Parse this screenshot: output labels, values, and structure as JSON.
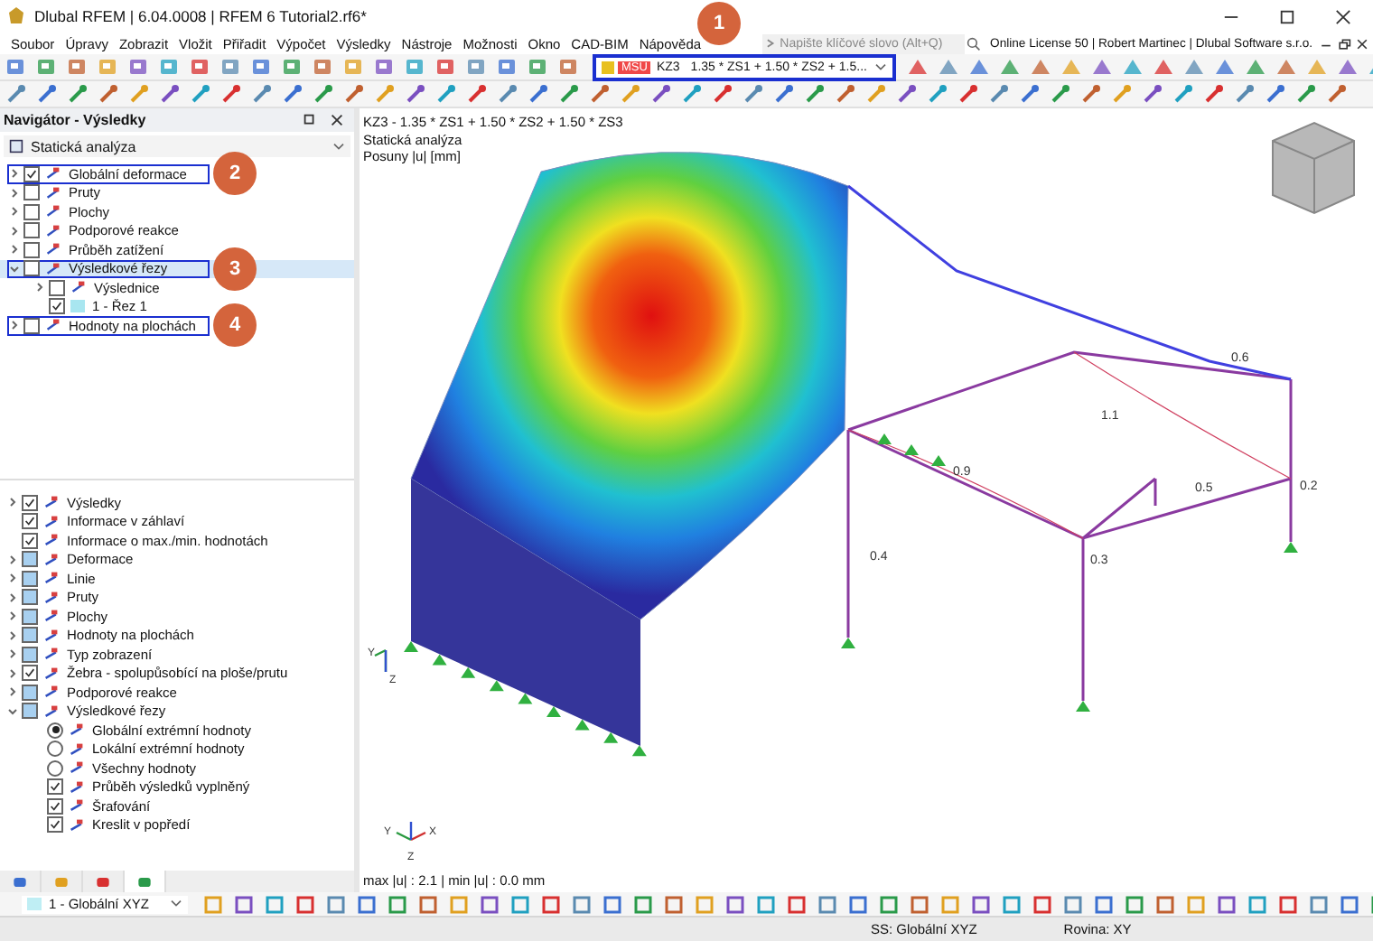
{
  "window": {
    "title": "Dlubal RFEM | 6.04.0008 | RFEM 6 Tutorial2.rf6*"
  },
  "menu": [
    "Soubor",
    "Úpravy",
    "Zobrazit",
    "Vložit",
    "Přiřadit",
    "Výpočet",
    "Výsledky",
    "Nástroje",
    "Možnosti",
    "Okno",
    "CAD-BIM",
    "Nápověda"
  ],
  "search": {
    "placeholder": "Napište klíčové slovo (Alt+Q)"
  },
  "license": "Online License 50 | Robert Martinec | Dlubal Software s.r.o.",
  "load_combination": {
    "type": "MSU",
    "name": "KZ3",
    "formula": "1.35 * ZS1 + 1.50 * ZS2 + 1.5...",
    "highlighted": true,
    "callout": "1"
  },
  "navigator": {
    "title": "Navigátor - Výsledky",
    "analysis": "Statická analýza",
    "tree": [
      {
        "label": "Globální deformace",
        "checked": true,
        "expanded": false,
        "highlighted": true,
        "callout": "2",
        "selected": false
      },
      {
        "label": "Pruty",
        "checked": false,
        "expanded": false,
        "highlighted": false,
        "selected": false
      },
      {
        "label": "Plochy",
        "checked": false,
        "expanded": false,
        "highlighted": false,
        "selected": false
      },
      {
        "label": "Podporové reakce",
        "checked": false,
        "expanded": false,
        "highlighted": false,
        "selected": false
      },
      {
        "label": "Průběh zatížení",
        "checked": false,
        "expanded": false,
        "highlighted": false,
        "selected": false
      },
      {
        "label": "Výsledkové řezy",
        "checked": false,
        "expanded": true,
        "highlighted": true,
        "callout": "3",
        "selected": true,
        "children": [
          {
            "label": "Výslednice",
            "checked": false,
            "expanded": false,
            "highlighted": false,
            "selected": false
          },
          {
            "label": "1 - Řez 1",
            "checked": true,
            "highlighted": false,
            "selected": false,
            "color": "#a8e6f0"
          }
        ]
      },
      {
        "label": "Hodnoty na plochách",
        "checked": false,
        "expanded": false,
        "highlighted": true,
        "callout": "4",
        "selected": false
      }
    ],
    "display": [
      {
        "kind": "checkbox",
        "label": "Výsledky",
        "checked": true,
        "mixed": false,
        "expanded": false
      },
      {
        "kind": "checkbox",
        "label": "Informace v záhlaví",
        "checked": true,
        "mixed": false
      },
      {
        "kind": "checkbox",
        "label": "Informace o max./min. hodnotách",
        "checked": true,
        "mixed": false
      },
      {
        "kind": "checkbox",
        "label": "Deformace",
        "checked": false,
        "mixed": true,
        "expanded": false
      },
      {
        "kind": "checkbox",
        "label": "Linie",
        "checked": false,
        "mixed": true,
        "expanded": false
      },
      {
        "kind": "checkbox",
        "label": "Pruty",
        "checked": false,
        "mixed": true,
        "expanded": false
      },
      {
        "kind": "checkbox",
        "label": "Plochy",
        "checked": false,
        "mixed": true,
        "expanded": false
      },
      {
        "kind": "checkbox",
        "label": "Hodnoty na plochách",
        "checked": false,
        "mixed": true,
        "expanded": false
      },
      {
        "kind": "checkbox",
        "label": "Typ zobrazení",
        "checked": false,
        "mixed": true,
        "expanded": false
      },
      {
        "kind": "checkbox",
        "label": "Žebra - spolupůsobící na ploše/prutu",
        "checked": true,
        "mixed": false,
        "expanded": false
      },
      {
        "kind": "checkbox",
        "label": "Podporové reakce",
        "checked": false,
        "mixed": true,
        "expanded": false
      },
      {
        "kind": "checkbox",
        "label": "Výsledkové řezy",
        "checked": false,
        "mixed": true,
        "expanded": true,
        "children": [
          {
            "kind": "radio",
            "label": "Globální extrémní hodnoty",
            "selected": true
          },
          {
            "kind": "radio",
            "label": "Lokální extrémní hodnoty",
            "selected": false
          },
          {
            "kind": "radio",
            "label": "Všechny hodnoty",
            "selected": false
          },
          {
            "kind": "checkbox",
            "label": "Průběh výsledků vyplněný",
            "checked": true,
            "mixed": false
          },
          {
            "kind": "checkbox",
            "label": "Šrafování",
            "checked": true,
            "mixed": false
          },
          {
            "kind": "checkbox",
            "label": "Kreslit v popředí",
            "checked": true,
            "mixed": false
          }
        ]
      }
    ],
    "tabs": [
      {
        "selected": false
      },
      {
        "selected": false
      },
      {
        "selected": false
      },
      {
        "selected": true
      }
    ],
    "coordinate_system": "1 - Globální XYZ"
  },
  "viewport": {
    "header": [
      "KZ3 - 1.35 * ZS1 + 1.50 * ZS2 + 1.50 * ZS3",
      "Statická analýza",
      "Posuny |u| [mm]"
    ],
    "value_labels": [
      "0.6",
      "1.1",
      "0.9",
      "0.5",
      "0.2",
      "0.3",
      "0.4"
    ],
    "axes": [
      {
        "labels": [
          "Y",
          "Z"
        ]
      },
      {
        "labels": [
          "Y",
          "X",
          "Z"
        ]
      }
    ],
    "summary": "max |u| : 2.1 | min |u| : 0.0 mm"
  },
  "status_bar": [
    "SS: Globální XYZ",
    "Rovina: XY"
  ]
}
